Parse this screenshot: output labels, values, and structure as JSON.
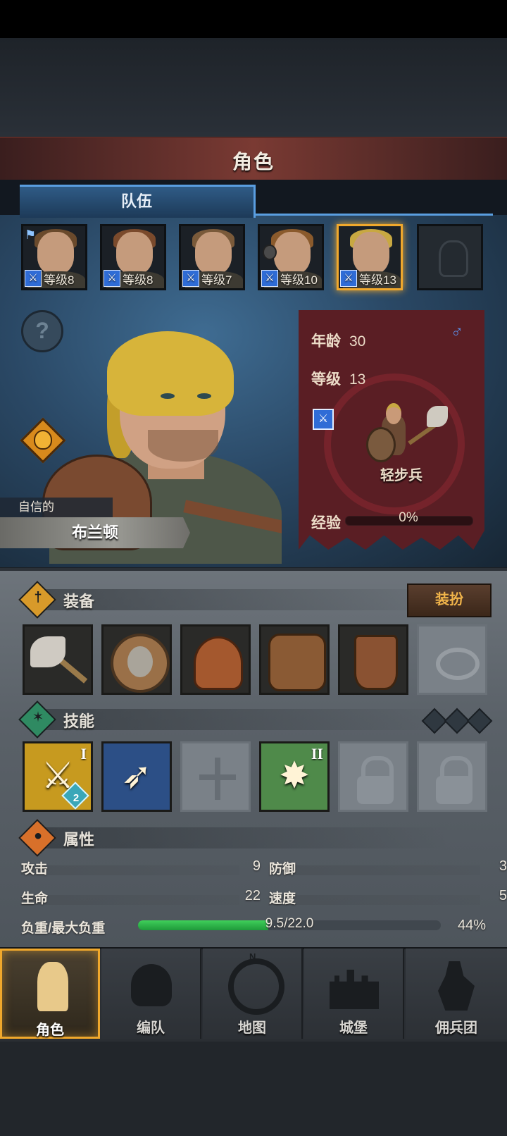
{
  "header": {
    "title": "角色"
  },
  "tabs": [
    {
      "label": "队伍",
      "active": true
    }
  ],
  "roster": [
    {
      "level_text": "等级8",
      "hair": "#6a4a2c",
      "selected": false,
      "flag": true
    },
    {
      "level_text": "等级8",
      "hair": "#7a4a2c",
      "selected": false
    },
    {
      "level_text": "等级7",
      "hair": "#7a5a3a",
      "selected": false
    },
    {
      "level_text": "等级10",
      "hair": "#8a5a2c",
      "selected": false,
      "companion": true
    },
    {
      "level_text": "等级13",
      "hair": "#c8a842",
      "selected": true
    }
  ],
  "character": {
    "trait": "自信的",
    "name": "布兰顿",
    "age_label": "年龄",
    "age": "30",
    "level_label": "等级",
    "level": "13",
    "gender_icon": "♂",
    "class_name": "轻步兵",
    "exp_label": "经验",
    "exp_text": "0%",
    "exp_fraction": 0
  },
  "equipment": {
    "title": "装备",
    "button": "装扮",
    "slots": [
      "battle-axe",
      "round-shield",
      "leather-helmet",
      "leather-armor",
      "leather-boots",
      "empty-ring"
    ]
  },
  "skills": {
    "title": "技能",
    "items": [
      {
        "icon": "sword-strike",
        "rank": "I",
        "badge": "2",
        "bg": "#c79a1f"
      },
      {
        "icon": "eagle-strike",
        "rank": "",
        "bg": "#2c4f86"
      },
      {
        "icon": "empty-cross",
        "rank": ""
      },
      {
        "icon": "burst",
        "rank": "II",
        "bg": "#4f8a4a"
      },
      {
        "icon": "lock"
      },
      {
        "icon": "lock"
      }
    ]
  },
  "attributes": {
    "title": "属性",
    "attack_label": "攻击",
    "attack": "9",
    "defense_label": "防御",
    "defense": "3",
    "hp_label": "生命",
    "hp": "22",
    "speed_label": "速度",
    "speed": "5",
    "load_label": "负重/最大负重",
    "load_text": "9.5/22.0",
    "load_percent": "44%",
    "load_fraction": 0.43
  },
  "nav": [
    {
      "label": "角色",
      "active": true
    },
    {
      "label": "编队"
    },
    {
      "label": "地图"
    },
    {
      "label": "城堡"
    },
    {
      "label": "佣兵团"
    }
  ],
  "colors": {
    "accent": "#f0a82c",
    "tab_blue": "#5a9ee0",
    "banner_red": "#5a1e24",
    "load_green": "#2fb54a"
  }
}
